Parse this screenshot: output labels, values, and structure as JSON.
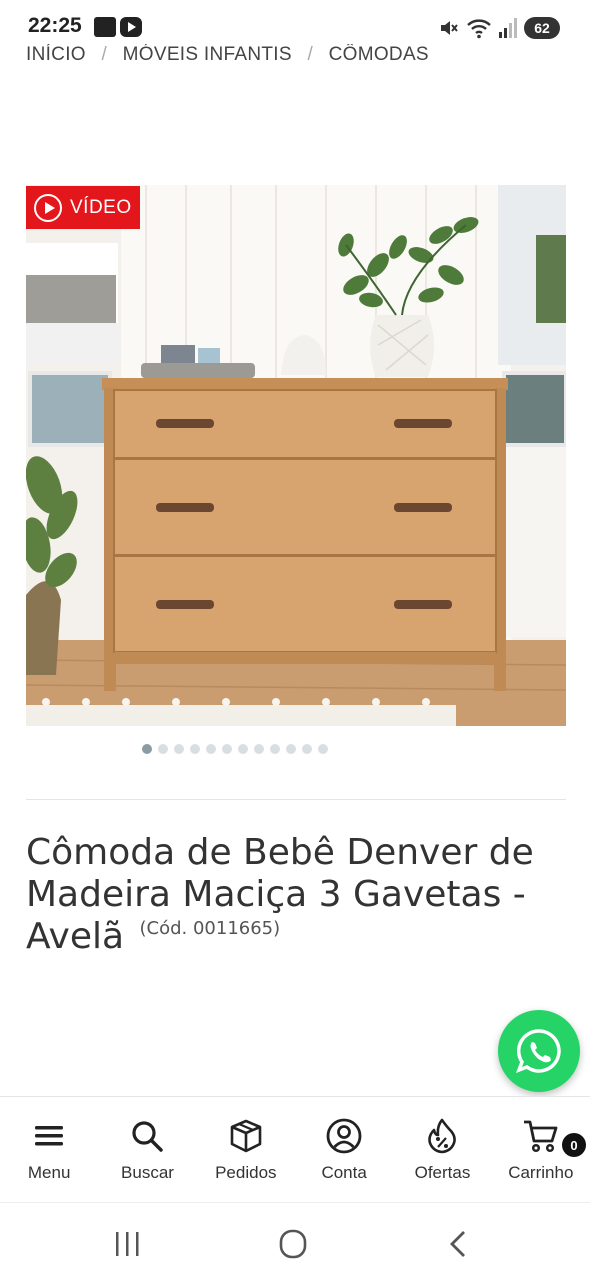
{
  "status_bar": {
    "time": "22:25",
    "battery": "62",
    "icons": [
      "notification-app-icon",
      "youtube-icon",
      "mute-icon",
      "wifi-icon",
      "signal-icon"
    ]
  },
  "breadcrumb": {
    "items": [
      "INÍCIO",
      "MÓVEIS INFANTIS",
      "CÔMODAS"
    ],
    "separator": "/"
  },
  "gallery": {
    "video_badge": "VÍDEO",
    "dot_count": 12,
    "active_dot": 0
  },
  "product": {
    "title": "Cômoda de Bebê Denver de Madeira Maciça 3 Gavetas - Avelã",
    "code": "(Cód. 0011665)"
  },
  "bottom_nav": {
    "items": [
      {
        "label": "Menu",
        "icon": "menu-icon"
      },
      {
        "label": "Buscar",
        "icon": "search-icon"
      },
      {
        "label": "Pedidos",
        "icon": "box-icon"
      },
      {
        "label": "Conta",
        "icon": "account-icon"
      },
      {
        "label": "Ofertas",
        "icon": "offers-icon"
      },
      {
        "label": "Carrinho",
        "icon": "cart-icon"
      }
    ],
    "cart_count": "0"
  },
  "colors": {
    "video_badge": "#e3161b",
    "whatsapp": "#25d366",
    "text": "#333333",
    "wood": "#d3a06a"
  }
}
